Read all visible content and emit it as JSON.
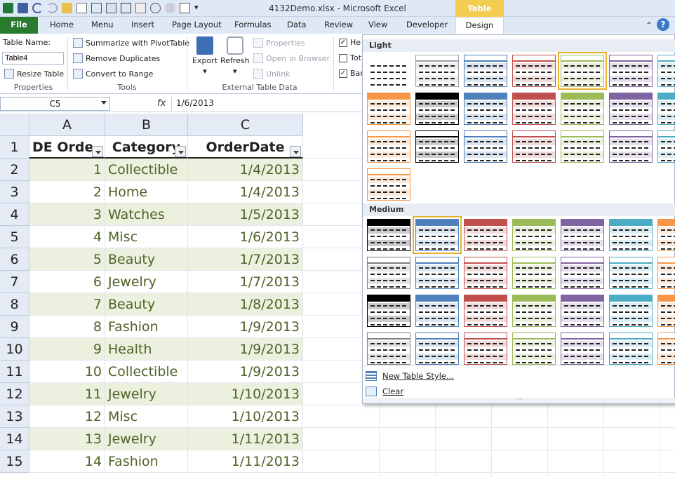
{
  "window": {
    "title": "4132Demo.xlsx - Microsoft Excel",
    "contextual_title": "Table Tools"
  },
  "tabs": [
    "File",
    "Home",
    "Menu",
    "Insert",
    "Page Layout",
    "Formulas",
    "Data",
    "Review",
    "View",
    "Developer",
    "Design"
  ],
  "ribbon": {
    "properties": {
      "table_name_label": "Table Name:",
      "table_name_value": "Table4",
      "resize": "Resize Table",
      "group": "Properties"
    },
    "tools": {
      "summarize": "Summarize with PivotTable",
      "remove": "Remove Duplicates",
      "convert": "Convert to Range",
      "group": "Tools"
    },
    "external": {
      "export": "Export",
      "refresh": "Refresh",
      "properties": "Properties",
      "open_browser": "Open in Browser",
      "unlink": "Unlink",
      "group": "External Table Data"
    },
    "options": {
      "header": "He",
      "total": "Tot",
      "banded": "Ban"
    }
  },
  "formula_bar": {
    "name_box": "C5",
    "fx": "fx",
    "value": "1/6/2013"
  },
  "sheet": {
    "columns": [
      "A",
      "B",
      "C"
    ],
    "headers": [
      "DE Orde",
      "Category",
      "OrderDate"
    ],
    "row_numbers": [
      "1",
      "2",
      "3",
      "4",
      "5",
      "6",
      "7",
      "8",
      "9",
      "10",
      "11",
      "12",
      "13",
      "14",
      "15"
    ],
    "rows": [
      {
        "a": "1",
        "b": "Collectible",
        "c": "1/4/2013"
      },
      {
        "a": "2",
        "b": "Home",
        "c": "1/4/2013"
      },
      {
        "a": "3",
        "b": "Watches",
        "c": "1/5/2013"
      },
      {
        "a": "4",
        "b": "Misc",
        "c": "1/6/2013"
      },
      {
        "a": "5",
        "b": "Beauty",
        "c": "1/7/2013"
      },
      {
        "a": "6",
        "b": "Jewelry",
        "c": "1/7/2013"
      },
      {
        "a": "7",
        "b": "Beauty",
        "c": "1/8/2013"
      },
      {
        "a": "8",
        "b": "Fashion",
        "c": "1/9/2013"
      },
      {
        "a": "9",
        "b": "Health",
        "c": "1/9/2013"
      },
      {
        "a": "10",
        "b": "Collectible",
        "c": "1/9/2013"
      },
      {
        "a": "11",
        "b": "Jewelry",
        "c": "1/10/2013"
      },
      {
        "a": "12",
        "b": "Misc",
        "c": "1/10/2013"
      },
      {
        "a": "13",
        "b": "Jewelry",
        "c": "1/11/2013"
      },
      {
        "a": "14",
        "b": "Fashion",
        "c": "1/11/2013"
      }
    ]
  },
  "gallery": {
    "light_label": "Light",
    "medium_label": "Medium",
    "new_style": "New Table Style...",
    "clear": "Clear",
    "light_colors": [
      "#ffffff",
      "#9aa0a8",
      "#4f81bd",
      "#c0504d",
      "#9bbb59",
      "#8064a2",
      "#4bacc6",
      "#f79646",
      "#000000",
      "#4f81bd",
      "#c0504d",
      "#9bbb59",
      "#8064a2",
      "#4bacc6",
      "#f79646",
      "#000000",
      "#4f81bd",
      "#c0504d",
      "#9bbb59",
      "#8064a2",
      "#4bacc6",
      "#f79646"
    ],
    "medium_colors": [
      "#000000",
      "#4f81bd",
      "#c0504d",
      "#9bbb59",
      "#8064a2",
      "#4bacc6",
      "#f79646",
      "#7f7f7f",
      "#4f81bd",
      "#c0504d",
      "#9bbb59",
      "#8064a2",
      "#4bacc6",
      "#f79646",
      "#000000",
      "#4f81bd",
      "#c0504d",
      "#9bbb59",
      "#8064a2",
      "#4bacc6",
      "#f79646",
      "#7f7f7f",
      "#4f81bd",
      "#c0504d",
      "#9bbb59",
      "#8064a2",
      "#4bacc6",
      "#f79646"
    ],
    "accent_selected": "#e6b12e"
  },
  "colors": {
    "file_tab": "#2a7a2e",
    "band": "#ebf1de",
    "text": "#4f6228",
    "contextual": "#f3cd4f"
  }
}
